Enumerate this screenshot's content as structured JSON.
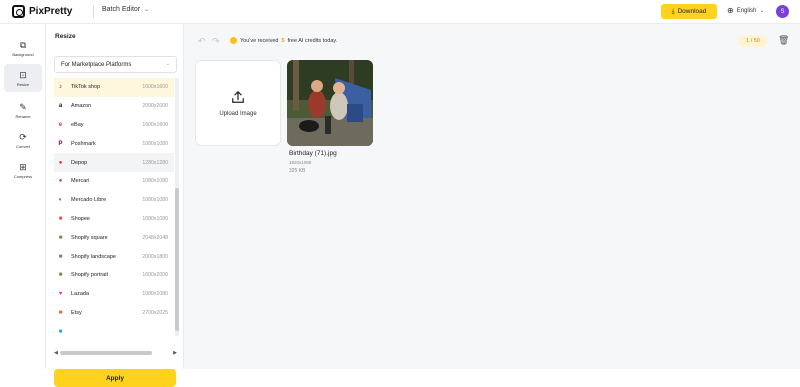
{
  "app": {
    "name": "PixPretty",
    "editor": "Batch Editor",
    "download": "Download",
    "language": "English",
    "avatar": "S"
  },
  "rail": [
    {
      "icon": "background-icon",
      "glyph": "⧉",
      "label": "Background"
    },
    {
      "icon": "resize-icon",
      "glyph": "⊡",
      "label": "Resize",
      "active": true
    },
    {
      "icon": "rename-icon",
      "glyph": "✎",
      "label": "Rename"
    },
    {
      "icon": "convert-icon",
      "glyph": "⟳",
      "label": "Convert"
    },
    {
      "icon": "compress-icon",
      "glyph": "⊞",
      "label": "Compress"
    }
  ],
  "panel": {
    "title": "Resize",
    "select": "For Marketplace Platforms",
    "apply": "Apply",
    "items": [
      {
        "name": "TikTok shop",
        "size": "1600x1600",
        "icon_color": "#111111",
        "glyph": "♪",
        "state": "selected"
      },
      {
        "name": "Amazon",
        "size": "2000x2000",
        "icon_color": "#111111",
        "glyph": "a"
      },
      {
        "name": "eBay",
        "size": "1600x1600",
        "icon_color": "#e53238",
        "glyph": "e"
      },
      {
        "name": "Poshmark",
        "size": "1080x1080",
        "icon_color": "#7f0353",
        "glyph": "P"
      },
      {
        "name": "Depop",
        "size": "1280x1280",
        "icon_color": "#ff2300",
        "glyph": "●",
        "state": "hover"
      },
      {
        "name": "Mercari",
        "size": "1080x1080",
        "icon_color": "#e0362c",
        "glyph": "●"
      },
      {
        "name": "Mercado Libre",
        "size": "1080x1080",
        "icon_color": "#2d3277",
        "glyph": "◐"
      },
      {
        "name": "Shopee",
        "size": "1080x1080",
        "icon_color": "#ee4d2d",
        "glyph": "■"
      },
      {
        "name": "Shopify square",
        "size": "2048x2048",
        "icon_color": "#5e8e3e",
        "glyph": "■"
      },
      {
        "name": "Shopify landscape",
        "size": "2000x1800",
        "icon_color": "#5e8e3e",
        "glyph": "■"
      },
      {
        "name": "Shopify portrait",
        "size": "1600x2000",
        "icon_color": "#5e8e3e",
        "glyph": "■"
      },
      {
        "name": "Lazada",
        "size": "1080x1080",
        "icon_color": "#f33f6b",
        "glyph": "♥"
      },
      {
        "name": "Etsy",
        "size": "2700x2025",
        "icon_color": "#f1641e",
        "glyph": "■"
      },
      {
        "name": "",
        "size": "",
        "icon_color": "#1da1f2",
        "glyph": "■"
      }
    ]
  },
  "main": {
    "credit_pre": "You've received",
    "credit_num": "5",
    "credit_post": "free AI credits today.",
    "count": "1 / 50",
    "upload_label": "Upload Image",
    "file": {
      "name": "Birthday (71).jpg",
      "dims": "1920x1080",
      "size": "325 KB"
    }
  }
}
